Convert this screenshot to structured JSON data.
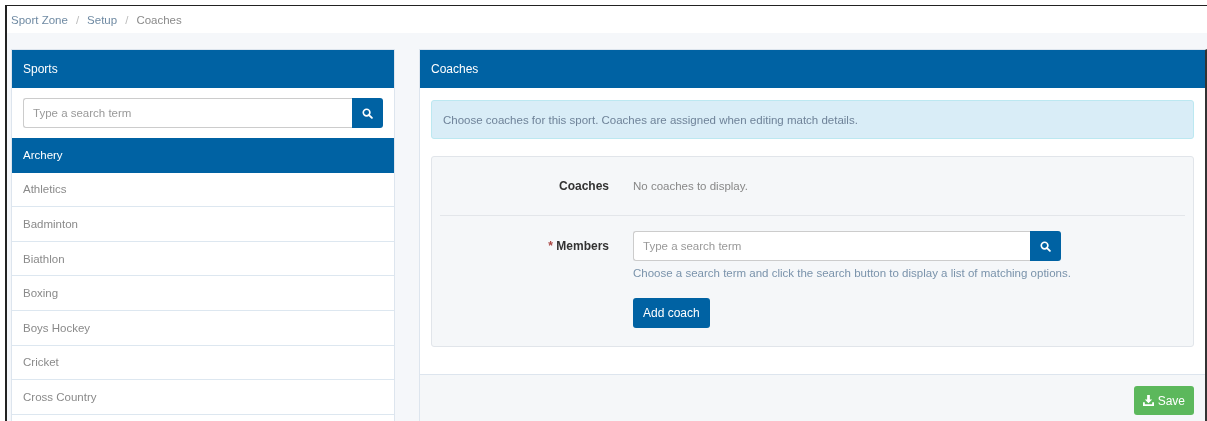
{
  "breadcrumb": {
    "separator": "/",
    "items": [
      {
        "label": "Sport Zone",
        "current": false
      },
      {
        "label": "Setup",
        "current": false
      },
      {
        "label": "Coaches",
        "current": true
      }
    ]
  },
  "sports_panel": {
    "title": "Sports",
    "search": {
      "placeholder": "Type a search term"
    },
    "items": [
      {
        "label": "Archery",
        "selected": true
      },
      {
        "label": "Athletics",
        "selected": false
      },
      {
        "label": "Badminton",
        "selected": false
      },
      {
        "label": "Biathlon",
        "selected": false
      },
      {
        "label": "Boxing",
        "selected": false
      },
      {
        "label": "Boys Hockey",
        "selected": false
      },
      {
        "label": "Cricket",
        "selected": false
      },
      {
        "label": "Cross Country",
        "selected": false
      }
    ]
  },
  "coaches_panel": {
    "title": "Coaches",
    "info": "Choose coaches for this sport. Coaches are assigned when editing match details.",
    "coaches_field": {
      "label": "Coaches",
      "value": "No coaches to display."
    },
    "members_field": {
      "required_mark": "*",
      "label": "Members",
      "placeholder": "Type a search term",
      "help": "Choose a search term and click the search button to display a list of matching options."
    },
    "add_button": "Add coach",
    "save_button": "Save"
  }
}
